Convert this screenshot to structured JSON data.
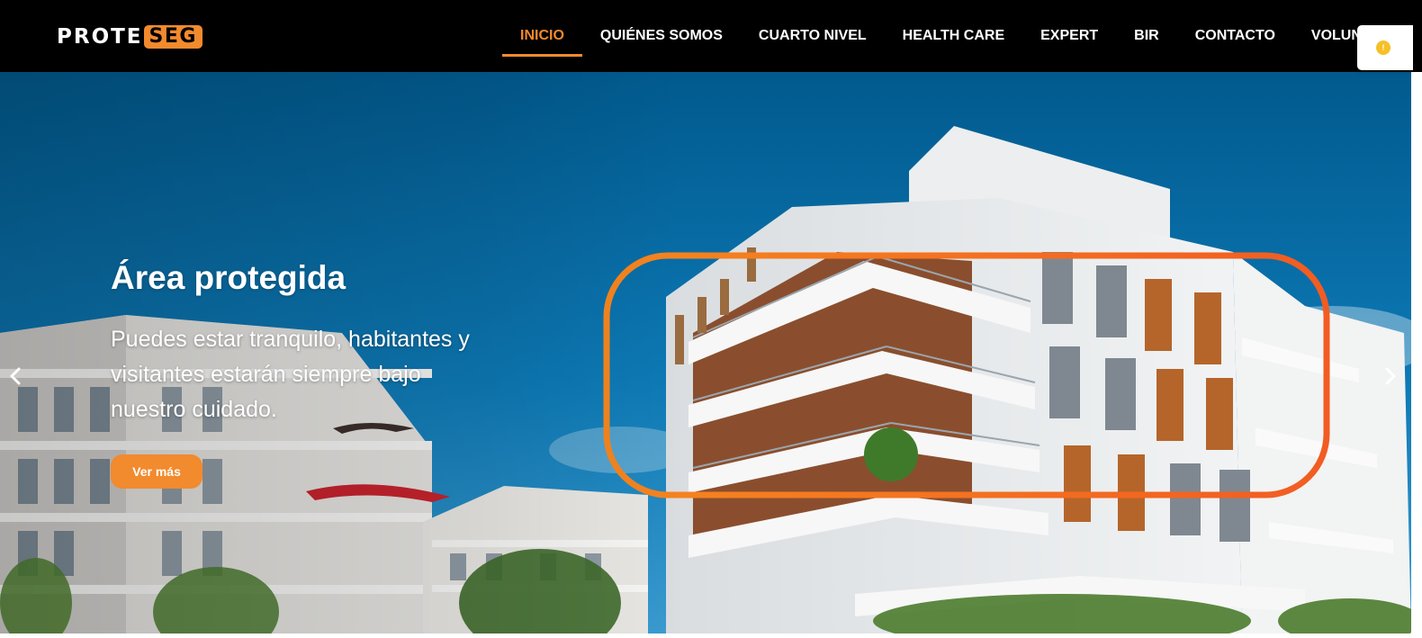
{
  "brand": {
    "part1": "PROTE",
    "part2": "SEG",
    "accent_color": "#f28a2e"
  },
  "nav": {
    "items": [
      {
        "label": "INICIO",
        "active": true
      },
      {
        "label": "QUIÉNES SOMOS"
      },
      {
        "label": "CUARTO NIVEL"
      },
      {
        "label": "HEALTH CARE"
      },
      {
        "label": "EXPERT"
      },
      {
        "label": "BIR"
      },
      {
        "label": "CONTACTO"
      },
      {
        "label": "VOLUNTA"
      }
    ]
  },
  "notification": {
    "icon": "info-icon",
    "color": "#f6c026"
  },
  "hero": {
    "title": "Área protegida",
    "text": "Puedes estar tranquilo, habitantes y visitantes estarán siempre bajo nuestro cuidado.",
    "button_label": "Ver más",
    "prev_icon": "chevron-left-icon",
    "next_icon": "chevron-right-icon",
    "image": "modern-apartment-buildings-photo"
  }
}
